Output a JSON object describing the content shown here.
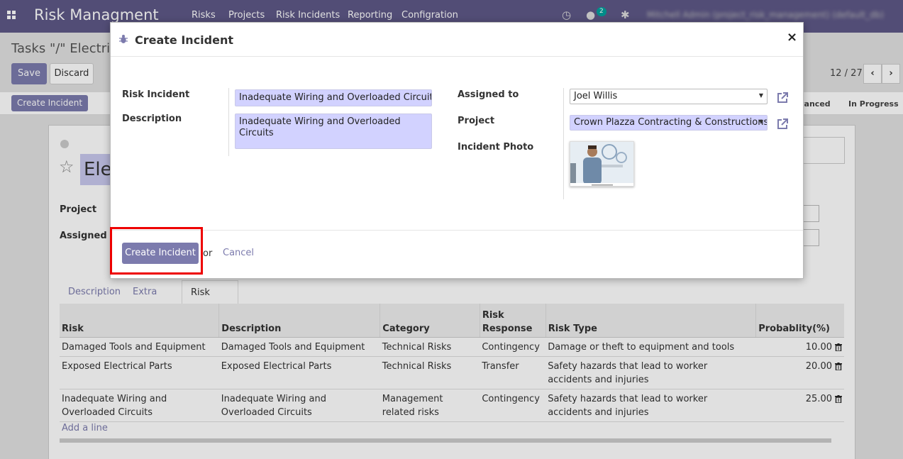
{
  "navbar": {
    "brand": "Risk Managment",
    "menu": [
      "Risks",
      "Projects",
      "Risk Incidents",
      "Reporting",
      "Configration"
    ],
    "chat_badge": "2",
    "user": "Mitchell Admin (project_risk_management) (default_db)"
  },
  "background": {
    "breadcrumb": "Tasks \"/\" Electrical",
    "save_label": "Save",
    "discard_label": "Discard",
    "pager": "12 / 27",
    "create_incident_label": "Create Incident",
    "stage_advanced": "Advanced",
    "stage_in_progress": "In Progress",
    "record_title": "Ele",
    "project_label": "Project",
    "assigned_label": "Assigned to"
  },
  "modal": {
    "title": "Create Incident",
    "risk_incident_label": "Risk Incident",
    "risk_incident_value": "Inadequate Wiring and Overloaded Circuits",
    "description_label": "Description",
    "description_value": "Inadequate Wiring and Overloaded Circuits",
    "assigned_label": "Assigned to",
    "assigned_value": "Joel Willis",
    "project_label": "Project",
    "project_value": "Crown Plazza Contracting & Constructions",
    "photo_label": "Incident Photo",
    "create_button": "Create Incident",
    "or_text": "or",
    "cancel_link": "Cancel"
  },
  "tabs": [
    "Description",
    "Extra Info",
    "Risk Register"
  ],
  "table": {
    "headers": [
      "Risk",
      "Description",
      "Category",
      "Risk Response",
      "Risk Type",
      "Probablity(%)"
    ],
    "header_response_lines": [
      "Risk",
      "Response"
    ],
    "rows": [
      {
        "risk": "Damaged Tools and Equipment",
        "description": "Damaged Tools and Equipment",
        "category": "Technical Risks",
        "response": "Contingency",
        "type": "Damage or theft to equipment and tools",
        "prob": "10.00"
      },
      {
        "risk": "Exposed Electrical Parts",
        "description": "Exposed Electrical Parts",
        "category": "Technical Risks",
        "response": "Transfer",
        "type": "Safety hazards that lead to worker accidents and injuries",
        "prob": "20.00"
      },
      {
        "risk": "Inadequate Wiring and Overloaded Circuits",
        "description": "Inadequate Wiring and Overloaded Circuits",
        "category": "Management related risks",
        "response": "Contingency",
        "type": "Safety hazards that lead to worker accidents and injuries",
        "prob": "25.00"
      }
    ],
    "add_line": "Add a line"
  },
  "colors": {
    "primary": "#7c7bad",
    "navbar": "#5e5887",
    "highlight": "#e00000",
    "field_bg": "#d2d2ff"
  }
}
